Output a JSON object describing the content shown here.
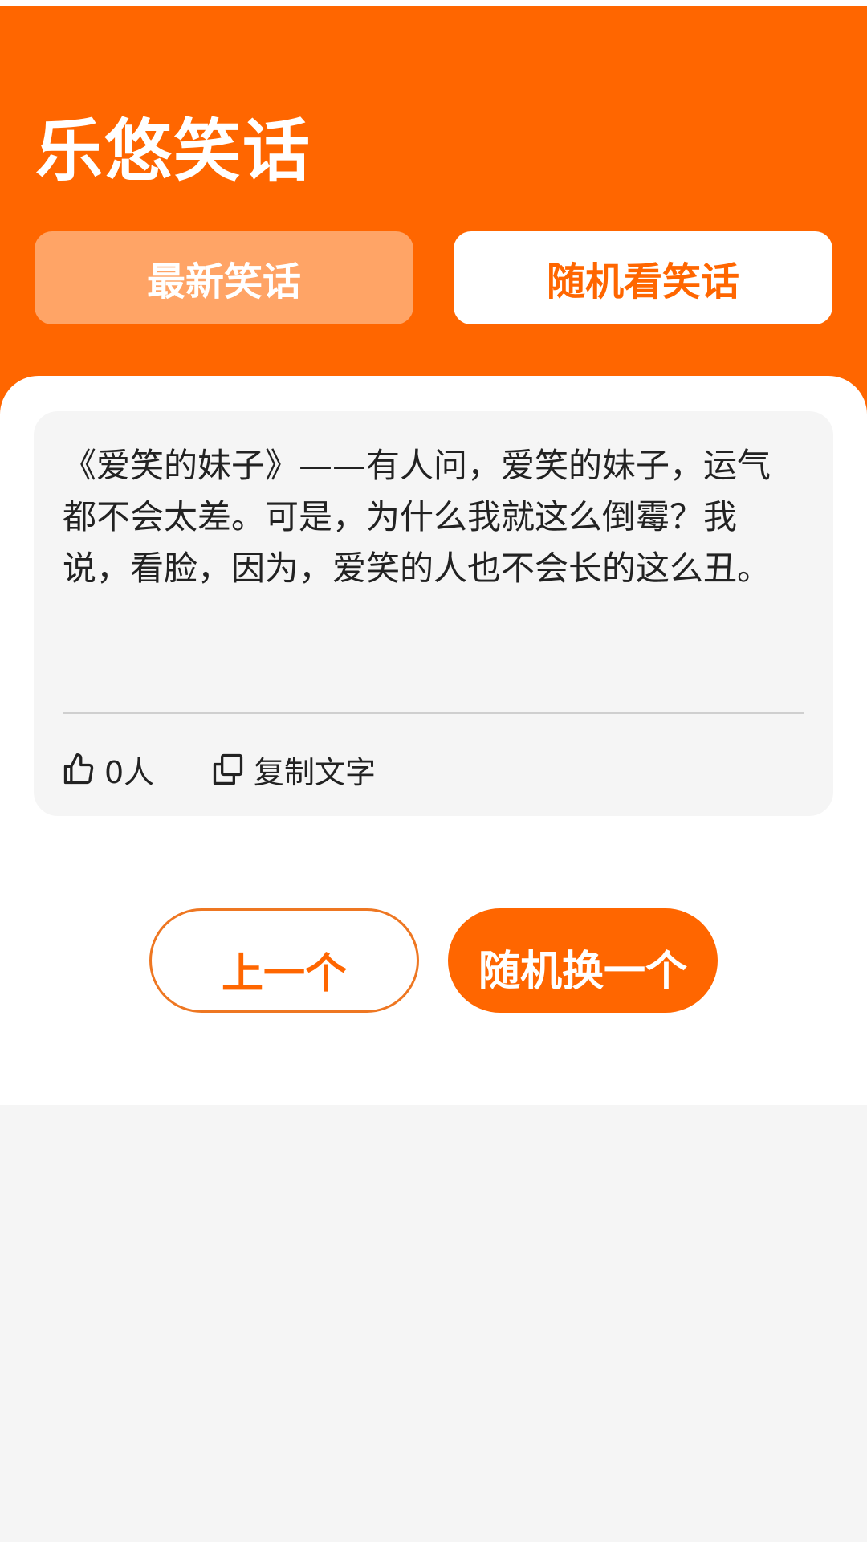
{
  "app": {
    "title": "乐悠笑话"
  },
  "tabs": [
    {
      "label": "最新笑话",
      "selected": false
    },
    {
      "label": "随机看笑话",
      "selected": true
    }
  ],
  "joke": {
    "text": "《爱笑的妹子》——有人问，爱笑的妹子，运气都不会太差。可是，为什么我就这么倒霉？我说，看脸，因为，爱笑的人也不会长的这么丑。",
    "likes_label": "0人",
    "copy_label": "复制文字"
  },
  "buttons": {
    "previous_label": "上一个",
    "random_label": "随机换一个"
  },
  "icons": {
    "like": "thumbs-up-icon",
    "copy": "copy-icon"
  },
  "colors": {
    "brand": "#FF6600",
    "tab_inactive": "#FFA466",
    "card_bg": "#F5F5F5",
    "text": "#222222"
  }
}
